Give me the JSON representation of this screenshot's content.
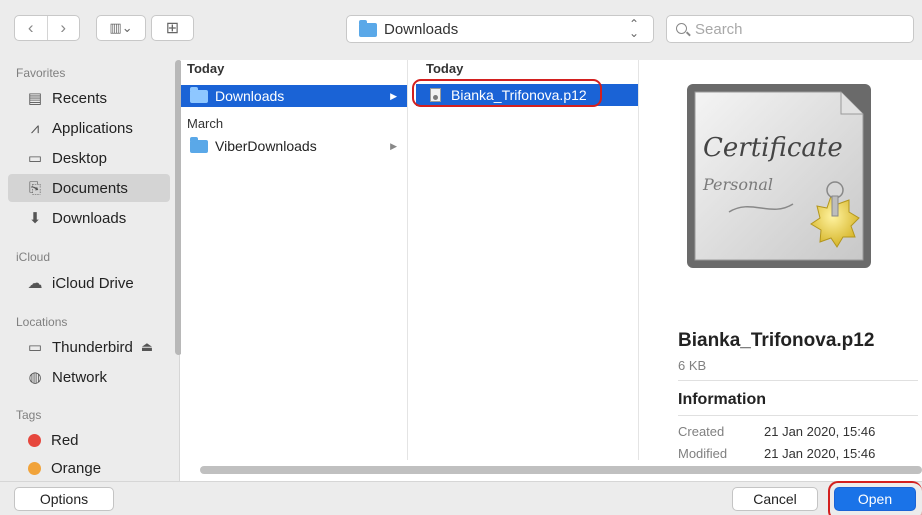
{
  "toolbar": {
    "back_glyph": "‹",
    "forward_glyph": "›",
    "view_glyph": "▥⌄",
    "newfolder_glyph": "⊞",
    "path_label": "Downloads",
    "search_placeholder": "Search"
  },
  "sidebar": {
    "favorites_heading": "Favorites",
    "favorites": [
      {
        "label": "Recents",
        "icon": "recents-icon",
        "glyph": "▤",
        "selected": false
      },
      {
        "label": "Applications",
        "icon": "applications-icon",
        "glyph": "⩘",
        "selected": false
      },
      {
        "label": "Desktop",
        "icon": "desktop-icon",
        "glyph": "▭",
        "selected": false
      },
      {
        "label": "Documents",
        "icon": "documents-icon",
        "glyph": "⎘",
        "selected": true
      },
      {
        "label": "Downloads",
        "icon": "downloads-icon",
        "glyph": "⬇",
        "selected": false
      }
    ],
    "icloud_heading": "iCloud",
    "icloud_items": [
      {
        "label": "iCloud Drive",
        "icon": "cloud-icon",
        "glyph": "☁"
      }
    ],
    "locations_heading": "Locations",
    "locations": [
      {
        "label": "Thunderbird",
        "icon": "disk-icon",
        "glyph": "▭",
        "eject": "⏏"
      },
      {
        "label": "Network",
        "icon": "network-icon",
        "glyph": "◍"
      }
    ],
    "tags_heading": "Tags",
    "tags": [
      {
        "label": "Red",
        "color": "#e6473d"
      },
      {
        "label": "Orange",
        "color": "#f1a33a"
      }
    ]
  },
  "column1": {
    "section_today": "Today",
    "section_march": "March",
    "rows": [
      {
        "label": "Downloads",
        "selected": true
      },
      {
        "label": "ViberDownloads",
        "selected": false
      }
    ]
  },
  "column2": {
    "section_today": "Today",
    "rows": [
      {
        "label": "Bianka_Trifonova.p12",
        "selected": true
      }
    ]
  },
  "preview": {
    "cert_title": "Certificate",
    "cert_subtitle": "Personal",
    "filename": "Bianka_Trifonova.p12",
    "size": "6 KB",
    "information_heading": "Information",
    "created_label": "Created",
    "created_value": "21 Jan 2020, 15:46",
    "modified_label": "Modified",
    "modified_value": "21 Jan 2020, 15:46"
  },
  "bottom": {
    "options_label": "Options",
    "cancel_label": "Cancel",
    "open_label": "Open"
  }
}
